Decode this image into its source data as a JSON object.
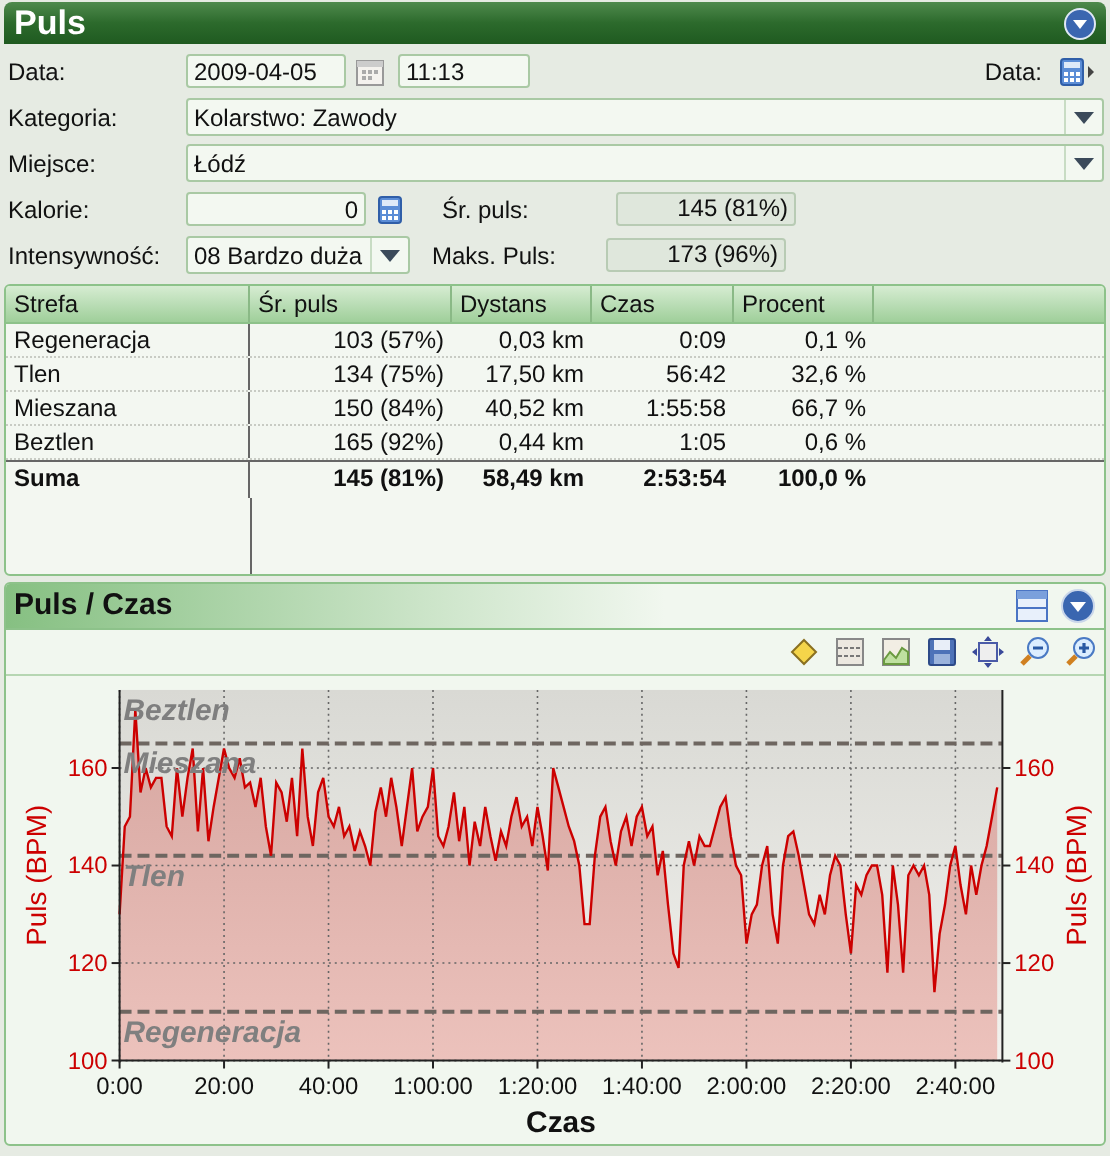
{
  "header": {
    "title": "Puls"
  },
  "form": {
    "date": {
      "label": "Data:",
      "value": "2009-04-05"
    },
    "time": {
      "value": "11:13"
    },
    "data_button": {
      "label": "Data:"
    },
    "category": {
      "label": "Kategoria:",
      "value": "Kolarstwo: Zawody"
    },
    "place": {
      "label": "Miejsce:",
      "value": "Łódź"
    },
    "calories": {
      "label": "Kalorie:",
      "value": "0"
    },
    "intensity": {
      "label": "Intensywność:",
      "value": "08 Bardzo duża"
    },
    "avg_pulse": {
      "label": "Śr. puls:",
      "value": "145 (81%)"
    },
    "max_pulse": {
      "label": "Maks. Puls:",
      "value": "173 (96%)"
    }
  },
  "zones_table": {
    "columns": [
      "Strefa",
      "Śr. puls",
      "Dystans",
      "Czas",
      "Procent"
    ],
    "rows": [
      [
        "Regeneracja",
        "103 (57%)",
        "0,03 km",
        "0:09",
        "0,1 %"
      ],
      [
        "Tlen",
        "134 (75%)",
        "17,50 km",
        "56:42",
        "32,6 %"
      ],
      [
        "Mieszana",
        "150 (84%)",
        "40,52 km",
        "1:55:58",
        "66,7 %"
      ],
      [
        "Beztlen",
        "165 (92%)",
        "0,44 km",
        "1:05",
        "0,6 %"
      ]
    ],
    "total": [
      "Suma",
      "145 (81%)",
      "58,49 km",
      "2:53:54",
      "100,0 %"
    ]
  },
  "chart_panel": {
    "title": "Puls / Czas",
    "chart_data": {
      "type": "area",
      "xlabel": "Czas",
      "ylabel": "Puls (BPM)",
      "y2label": "Puls (BPM)",
      "xlim": [
        0,
        169
      ],
      "ylim": [
        100,
        176
      ],
      "xticks": [
        {
          "value": 0,
          "label": "0:00"
        },
        {
          "value": 20,
          "label": "20:00"
        },
        {
          "value": 40,
          "label": "40:00"
        },
        {
          "value": 60,
          "label": "1:00:00"
        },
        {
          "value": 80,
          "label": "1:20:00"
        },
        {
          "value": 100,
          "label": "1:40:00"
        },
        {
          "value": 120,
          "label": "2:00:00"
        },
        {
          "value": 140,
          "label": "2:20:00"
        },
        {
          "value": 160,
          "label": "2:40:00"
        }
      ],
      "yticks": [
        100,
        120,
        140,
        160
      ],
      "y2lim": [
        100,
        176
      ],
      "y2ticks": [
        100,
        120,
        140,
        160
      ],
      "grid": true,
      "ref_lines": [
        {
          "axis": "y",
          "value": 165
        },
        {
          "axis": "y",
          "value": 142
        },
        {
          "axis": "y",
          "value": 110
        }
      ],
      "annotations": [
        "Beztlen",
        "Mieszana",
        "Tlen",
        "Regeneracja"
      ],
      "x": [
        0,
        1,
        2,
        3,
        4,
        5,
        6,
        7,
        8,
        9,
        10,
        11,
        12,
        13,
        14,
        15,
        16,
        17,
        18,
        19,
        20,
        21,
        22,
        23,
        24,
        25,
        26,
        27,
        28,
        29,
        30,
        31,
        32,
        33,
        34,
        35,
        36,
        37,
        38,
        39,
        40,
        41,
        42,
        43,
        44,
        45,
        46,
        47,
        48,
        49,
        50,
        51,
        52,
        53,
        54,
        55,
        56,
        57,
        58,
        59,
        60,
        61,
        62,
        63,
        64,
        65,
        66,
        67,
        68,
        69,
        70,
        71,
        72,
        73,
        74,
        75,
        76,
        77,
        78,
        79,
        80,
        81,
        82,
        83,
        84,
        85,
        86,
        87,
        88,
        89,
        90,
        91,
        92,
        93,
        94,
        95,
        96,
        97,
        98,
        99,
        100,
        101,
        102,
        103,
        104,
        105,
        106,
        107,
        108,
        109,
        110,
        111,
        112,
        113,
        114,
        115,
        116,
        117,
        118,
        119,
        120,
        121,
        122,
        123,
        124,
        125,
        126,
        127,
        128,
        129,
        130,
        131,
        132,
        133,
        134,
        135,
        136,
        137,
        138,
        139,
        140,
        141,
        142,
        143,
        144,
        145,
        146,
        147,
        148,
        149,
        150,
        151,
        152,
        153,
        154,
        155,
        156,
        157,
        158,
        159,
        160,
        161,
        162,
        163,
        164,
        165,
        166,
        167,
        168
      ],
      "series": [
        {
          "color": "#cc0000",
          "values": [
            130,
            148,
            150,
            172,
            155,
            160,
            156,
            158,
            158,
            148,
            146,
            160,
            150,
            158,
            164,
            147,
            160,
            145,
            152,
            158,
            164,
            160,
            158,
            162,
            156,
            157,
            152,
            158,
            148,
            142,
            157,
            155,
            149,
            158,
            146,
            164,
            150,
            144,
            155,
            158,
            150,
            148,
            152,
            146,
            148,
            143,
            147,
            144,
            140,
            151,
            156,
            150,
            158,
            152,
            144,
            152,
            160,
            147,
            150,
            152,
            160,
            146,
            144,
            148,
            155,
            145,
            152,
            140,
            149,
            144,
            152,
            146,
            141,
            147,
            144,
            150,
            154,
            148,
            150,
            144,
            152,
            146,
            139,
            160,
            156,
            152,
            148,
            145,
            140,
            128,
            128,
            142,
            150,
            152,
            145,
            140,
            147,
            150,
            144,
            150,
            152,
            146,
            148,
            138,
            143,
            132,
            122,
            119,
            140,
            145,
            140,
            146,
            144,
            144,
            148,
            152,
            154,
            146,
            140,
            138,
            124,
            130,
            132,
            140,
            144,
            130,
            124,
            140,
            146,
            147,
            142,
            136,
            130,
            128,
            134,
            130,
            138,
            142,
            140,
            130,
            122,
            136,
            134,
            138,
            140,
            140,
            134,
            118,
            140,
            132,
            118,
            138,
            140,
            138,
            140,
            134,
            114,
            126,
            132,
            140,
            144,
            136,
            130,
            140,
            134,
            140,
            144,
            150,
            156
          ]
        }
      ]
    }
  }
}
